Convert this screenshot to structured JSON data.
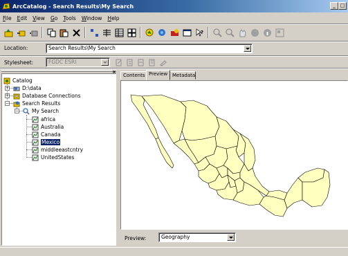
{
  "window": {
    "title": "ArcCatalog - Search Results\\My Search"
  },
  "menu": [
    "File",
    "Edit",
    "View",
    "Go",
    "Tools",
    "Window",
    "Help"
  ],
  "toolbar_icons": [
    "up-one-level-icon",
    "connect-folder-icon",
    "disconnect-folder-icon",
    "copy-icon",
    "paste-icon",
    "delete-icon",
    "large-icons-icon",
    "list-icon",
    "details-icon",
    "thumbnails-icon",
    "launch-arcmap-icon",
    "search-icon",
    "arctoolbox-icon",
    "full-screen-icon",
    "whats-this-icon",
    "zoom-in-icon",
    "zoom-out-icon",
    "pan-icon",
    "full-extent-icon",
    "identify-icon",
    "create-thumbnail-icon"
  ],
  "location": {
    "label": "Location:",
    "value": "Search Results\\My Search"
  },
  "stylesheet": {
    "label": "Stylesheet:",
    "value": "FGDC ESRI"
  },
  "tree": {
    "root": "Catalog",
    "items": [
      {
        "label": "D:\\data",
        "icon": "drive-icon"
      },
      {
        "label": "Database Connections",
        "icon": "database-connections-icon"
      },
      {
        "label": "Search Results",
        "icon": "search-results-icon"
      }
    ],
    "search": "My Search",
    "results": [
      "africa",
      "Australia",
      "Canada",
      "Mexico",
      "middleeastcntry",
      "UnitedStates"
    ],
    "selected": "Mexico"
  },
  "tabs": [
    "Contents",
    "Preview",
    "Metadata"
  ],
  "active_tab": "Preview",
  "preview": {
    "label": "Preview:",
    "value": "Geography"
  },
  "colors": {
    "map_fill": "#ffffc0",
    "selection": "#0a246a",
    "face": "#d4d0c8"
  }
}
